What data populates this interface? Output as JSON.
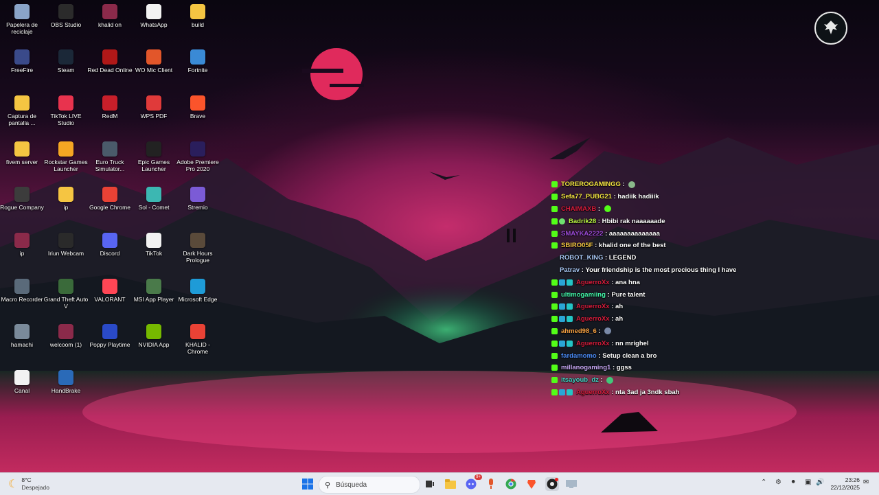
{
  "desktop_icons": [
    {
      "label": "Papelera de reciclaje",
      "icon": "recycle-bin-icon",
      "color": "#8aa4c8"
    },
    {
      "label": "OBS Studio",
      "icon": "obs-icon",
      "color": "#2b2b2b"
    },
    {
      "label": "khalid on",
      "icon": "winrar-icon",
      "color": "#8b2a4a"
    },
    {
      "label": "WhatsApp",
      "icon": "file-icon",
      "color": "#f2f2f2"
    },
    {
      "label": "build",
      "icon": "folder-icon",
      "color": "#f5c542"
    },
    {
      "label": "FreeFire",
      "icon": "freefire-icon",
      "color": "#3a4a8a"
    },
    {
      "label": "Steam",
      "icon": "steam-icon",
      "color": "#1b2838"
    },
    {
      "label": "Red Dead Online",
      "icon": "rdo-icon",
      "color": "#b01818"
    },
    {
      "label": "WO Mic Client",
      "icon": "microphone-icon",
      "color": "#e2562a"
    },
    {
      "label": "Fortnite",
      "icon": "fortnite-icon",
      "color": "#3a8ad6"
    },
    {
      "label": "Captura de pantalla ...",
      "icon": "folder-icon",
      "color": "#f5c542"
    },
    {
      "label": "TikTok LIVE Studio",
      "icon": "tiktok-live-icon",
      "color": "#e8334e"
    },
    {
      "label": "RedM",
      "icon": "redm-icon",
      "color": "#c81f2a"
    },
    {
      "label": "WPS PDF",
      "icon": "pdf-icon",
      "color": "#e03a3a"
    },
    {
      "label": "Brave",
      "icon": "brave-icon",
      "color": "#fb542b"
    },
    {
      "label": "fivem server",
      "icon": "folder-icon",
      "color": "#f5c542"
    },
    {
      "label": "Rockstar Games Launcher",
      "icon": "rockstar-icon",
      "color": "#f5a623"
    },
    {
      "label": "Euro Truck Simulator...",
      "icon": "truck-icon",
      "color": "#4a5a6a"
    },
    {
      "label": "Epic Games Launcher",
      "icon": "epic-icon",
      "color": "#222222"
    },
    {
      "label": "Adobe Premiere Pro 2020",
      "icon": "premiere-icon",
      "color": "#2a1e5c"
    },
    {
      "label": "Rogue Company",
      "icon": "rogue-company-icon",
      "color": "#3c3c3c"
    },
    {
      "label": "ip",
      "icon": "folder-icon",
      "color": "#f5c542"
    },
    {
      "label": "Google Chrome",
      "icon": "chrome-icon",
      "color": "#e94235"
    },
    {
      "label": "Sol - Comet",
      "icon": "comet-icon",
      "color": "#3cb7b2"
    },
    {
      "label": "Stremio",
      "icon": "stremio-icon",
      "color": "#7b5bd6"
    },
    {
      "label": "ip",
      "icon": "winrar-icon",
      "color": "#8b2a4a"
    },
    {
      "label": "Iriun Webcam",
      "icon": "webcam-icon",
      "color": "#2a2a2a"
    },
    {
      "label": "Discord",
      "icon": "discord-icon",
      "color": "#5865f2"
    },
    {
      "label": "TikTok",
      "icon": "file-icon",
      "color": "#f2f2f2"
    },
    {
      "label": "Dark Hours Prologue",
      "icon": "dark-hours-icon",
      "color": "#5a4a3a"
    },
    {
      "label": "Macro Recorder",
      "icon": "macro-recorder-icon",
      "color": "#5a6a7a"
    },
    {
      "label": "Grand Theft Auto V",
      "icon": "gta-icon",
      "color": "#3a6a3a"
    },
    {
      "label": "VALORANT",
      "icon": "valorant-icon",
      "color": "#ff4655"
    },
    {
      "label": "MSI App Player",
      "icon": "msi-icon",
      "color": "#4a7a4a"
    },
    {
      "label": "Microsoft Edge",
      "icon": "edge-icon",
      "color": "#1e9bd7"
    },
    {
      "label": "hamachi",
      "icon": "hamachi-icon",
      "color": "#7a8a9a"
    },
    {
      "label": "welcoom (1)",
      "icon": "winrar-icon",
      "color": "#8b2a4a"
    },
    {
      "label": "Poppy Playtime",
      "icon": "poppy-icon",
      "color": "#2a4ac8"
    },
    {
      "label": "NVIDIA App",
      "icon": "nvidia-icon",
      "color": "#76b900"
    },
    {
      "label": "KHALID - Chrome",
      "icon": "chrome-icon",
      "color": "#e94235"
    },
    {
      "label": "Canal",
      "icon": "canal-icon",
      "color": "#f2f2f2"
    },
    {
      "label": "HandBrake",
      "icon": "handbrake-icon",
      "color": "#2a6ab8"
    }
  ],
  "chat": [
    {
      "user": "TOREROGAMINGG",
      "color": "#f5e642",
      "badges": [
        "k"
      ],
      "message": "",
      "emote": "#8ab88a"
    },
    {
      "user": "Sefa77_PUBG21",
      "color": "#f5e642",
      "badges": [
        "k"
      ],
      "message": "hadiik hadiiik",
      "emote": ""
    },
    {
      "user": "CHAIMAXB",
      "color": "#d81c3c",
      "badges": [
        "k"
      ],
      "message": "",
      "emote": "#53fc18"
    },
    {
      "user": "Badrik28",
      "color": "#b8f542",
      "badges": [
        "k",
        "g"
      ],
      "message": "Hbibi rak naaaaaade",
      "emote": ""
    },
    {
      "user": "SMAYKA2222",
      "color": "#9b4ad6",
      "badges": [
        "k"
      ],
      "message": "aaaaaaaaaaaaaa",
      "emote": ""
    },
    {
      "user": "SBIRO05F",
      "color": "#f5c842",
      "badges": [
        "k"
      ],
      "message": "khalid one of the best",
      "emote": ""
    },
    {
      "user": "ROBOT_KING",
      "color": "#a8c8f5",
      "badges": [],
      "message": "LEGEND",
      "emote": ""
    },
    {
      "user": "Patrav",
      "color": "#a8c8f5",
      "badges": [],
      "message": "Your friendship is the most precious thing I have",
      "emote": ""
    },
    {
      "user": "AguerroXx",
      "color": "#d81c3c",
      "badges": [
        "k",
        "s",
        "t"
      ],
      "message": "ana hna",
      "emote": ""
    },
    {
      "user": "ultimogamiing",
      "color": "#42f5a8",
      "badges": [
        "k"
      ],
      "message": "Pure talent",
      "emote": ""
    },
    {
      "user": "AguerroXx",
      "color": "#d81c3c",
      "badges": [
        "k",
        "s",
        "t"
      ],
      "message": "ah",
      "emote": ""
    },
    {
      "user": "AguerroXx",
      "color": "#d81c3c",
      "badges": [
        "k",
        "s",
        "t"
      ],
      "message": "ah",
      "emote": ""
    },
    {
      "user": "ahmed98_6",
      "color": "#f5a042",
      "badges": [
        "k"
      ],
      "message": "",
      "emote": "#7a8aa8"
    },
    {
      "user": "AguerroXx",
      "color": "#d81c3c",
      "badges": [
        "k",
        "s",
        "t"
      ],
      "message": "nn mrighel",
      "emote": ""
    },
    {
      "user": "fardamomo",
      "color": "#4a8af5",
      "badges": [
        "k"
      ],
      "message": "Setup clean a bro",
      "emote": ""
    },
    {
      "user": "millanogaming1",
      "color": "#c8a8f5",
      "badges": [
        "k"
      ],
      "message": "ggss",
      "emote": ""
    },
    {
      "user": "itsayoub_dz",
      "color": "#42d6c8",
      "badges": [
        "k"
      ],
      "message": "",
      "emote": "#42c87a"
    },
    {
      "user": "AguerroXx",
      "color": "#d81c3c",
      "badges": [
        "k",
        "s",
        "t"
      ],
      "message": "nta 3ad ja 3ndk sbah",
      "emote": ""
    }
  ],
  "taskbar": {
    "weather_temp": "8°C",
    "weather_desc": "Despejado",
    "search_placeholder": "Búsqueda",
    "time": "23:26",
    "date": "22/12/2025",
    "discord_badge": "9+",
    "pinned": [
      "start-button",
      "search",
      "task-view-icon",
      "file-explorer-icon",
      "discord-icon",
      "microphone-icon",
      "chrome-icon",
      "brave-icon",
      "obs-icon",
      "screen-icon"
    ]
  },
  "colors": {
    "accent_kick": "#53fc18",
    "taskbar_bg": "#e6e9f0"
  }
}
